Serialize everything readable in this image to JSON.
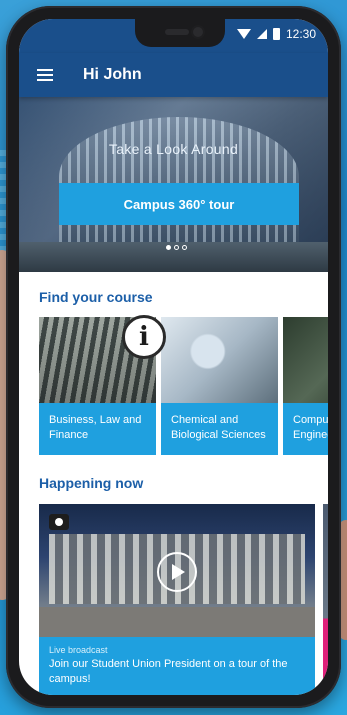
{
  "status_bar": {
    "time": "12:30"
  },
  "app_bar": {
    "title": "Hi John"
  },
  "hero": {
    "caption": "Take a Look Around",
    "button_label": "Campus 360° tour",
    "carousel_position": 1,
    "carousel_count": 3
  },
  "find_course": {
    "heading": "Find your course",
    "courses": [
      {
        "label": "Business, Law and Finance"
      },
      {
        "label": "Chemical and Biological Sciences"
      },
      {
        "label": "Computing Engineer"
      }
    ]
  },
  "happening_now": {
    "heading": "Happening now",
    "event": {
      "kicker": "Live broadcast",
      "title": "Join our Student Union President on a tour of the campus!"
    }
  },
  "colors": {
    "brand_dark": "#1a4f8b",
    "accent": "#1fa0df",
    "heading": "#1c5fa8"
  }
}
